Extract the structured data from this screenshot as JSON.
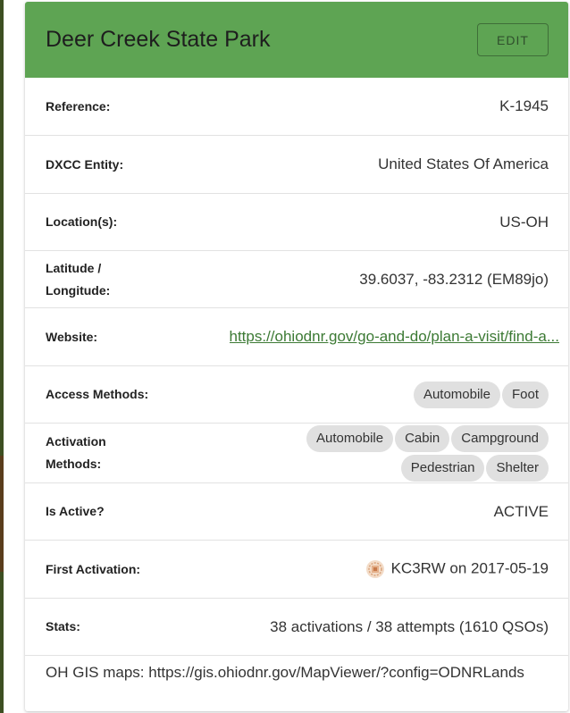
{
  "park": {
    "name": "Deer Creek State Park",
    "edit_label": "EDIT"
  },
  "details": {
    "reference": {
      "label": "Reference:",
      "value": "K-1945"
    },
    "dxcc": {
      "label": "DXCC Entity:",
      "value": "United States Of America"
    },
    "location": {
      "label": "Location(s):",
      "value": "US-OH"
    },
    "latlon": {
      "label_line1": "Latitude /",
      "label_line2": "Longitude:",
      "value": "39.6037, -83.2312 (EM89jo)"
    },
    "website": {
      "label": "Website:",
      "value": "https://ohiodnr.gov/go-and-do/plan-a-visit/find-a..."
    },
    "access_methods": {
      "label": "Access Methods:",
      "chips": [
        "Automobile",
        "Foot"
      ]
    },
    "activation_methods": {
      "label_line1": "Activation",
      "label_line2": "Methods:",
      "chips": [
        "Automobile",
        "Cabin",
        "Campground",
        "Pedestrian",
        "Shelter"
      ]
    },
    "is_active": {
      "label": "Is Active?",
      "value": "ACTIVE"
    },
    "first_activation": {
      "label": "First Activation:",
      "value": "KC3RW on 2017-05-19",
      "icon": "award-badge-icon"
    },
    "stats": {
      "label": "Stats:",
      "value": "38 activations / 38 attempts (1610 QSOs)"
    }
  },
  "notes": "OH GIS maps: https://gis.ohiodnr.gov/MapViewer/?config=ODNRLands",
  "colors": {
    "header_bg": "#5ea453",
    "link": "#3c7a34",
    "chip_bg": "#e0e0e0"
  }
}
